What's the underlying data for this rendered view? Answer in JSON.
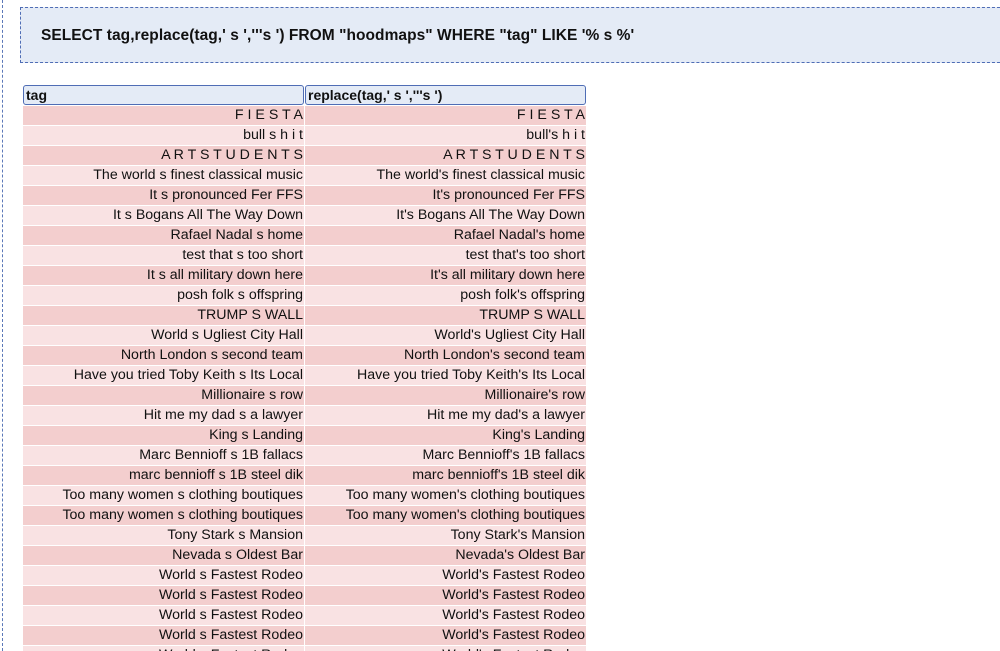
{
  "query": {
    "text": "SELECT tag,replace(tag,' s ','''s ') FROM \"hoodmaps\" WHERE \"tag\" LIKE '% s %'"
  },
  "results": {
    "columns": [
      "tag",
      "replace(tag,' s ','''s ')"
    ],
    "rows": [
      [
        "F I E S T A",
        "F I E S T A"
      ],
      [
        "bull s h i t",
        "bull's h i t"
      ],
      [
        "A R T S T U D E N T S",
        "A R T S T U D E N T S"
      ],
      [
        "The world s finest classical music",
        "The world's finest classical music"
      ],
      [
        "It s pronounced Fer FFS",
        "It's pronounced Fer FFS"
      ],
      [
        "It s Bogans All The Way Down",
        "It's Bogans All The Way Down"
      ],
      [
        "Rafael Nadal s home",
        "Rafael Nadal's home"
      ],
      [
        "test that s too short",
        "test that's too short"
      ],
      [
        "It s all military down here",
        "It's all military down here"
      ],
      [
        "posh folk s offspring",
        "posh folk's offspring"
      ],
      [
        "TRUMP S WALL",
        "TRUMP S WALL"
      ],
      [
        "World s Ugliest City Hall",
        "World's Ugliest City Hall"
      ],
      [
        "North London s second team",
        "North London's second team"
      ],
      [
        "Have you tried Toby Keith s Its Local",
        "Have you tried Toby Keith's Its Local"
      ],
      [
        "Millionaire s row",
        "Millionaire's row"
      ],
      [
        "Hit me my dad s a lawyer",
        "Hit me my dad's a lawyer"
      ],
      [
        "King s Landing",
        "King's Landing"
      ],
      [
        "Marc Bennioff s 1B fallacs",
        "Marc Bennioff's 1B fallacs"
      ],
      [
        "marc bennioff s 1B steel dik",
        "marc bennioff's 1B steel dik"
      ],
      [
        "Too many women s clothing boutiques",
        "Too many women's clothing boutiques"
      ],
      [
        "Too many women s clothing boutiques",
        "Too many women's clothing boutiques"
      ],
      [
        "Tony Stark s Mansion",
        "Tony Stark's Mansion"
      ],
      [
        "Nevada s Oldest Bar",
        "Nevada's Oldest Bar"
      ],
      [
        "World s Fastest Rodeo",
        "World's Fastest Rodeo"
      ],
      [
        "World s Fastest Rodeo",
        "World's Fastest Rodeo"
      ],
      [
        "World s Fastest Rodeo",
        "World's Fastest Rodeo"
      ],
      [
        "World s Fastest Rodeo",
        "World's Fastest Rodeo"
      ],
      [
        "World s Fastest Rodeo",
        "World's Fastest Rodeo"
      ]
    ]
  }
}
